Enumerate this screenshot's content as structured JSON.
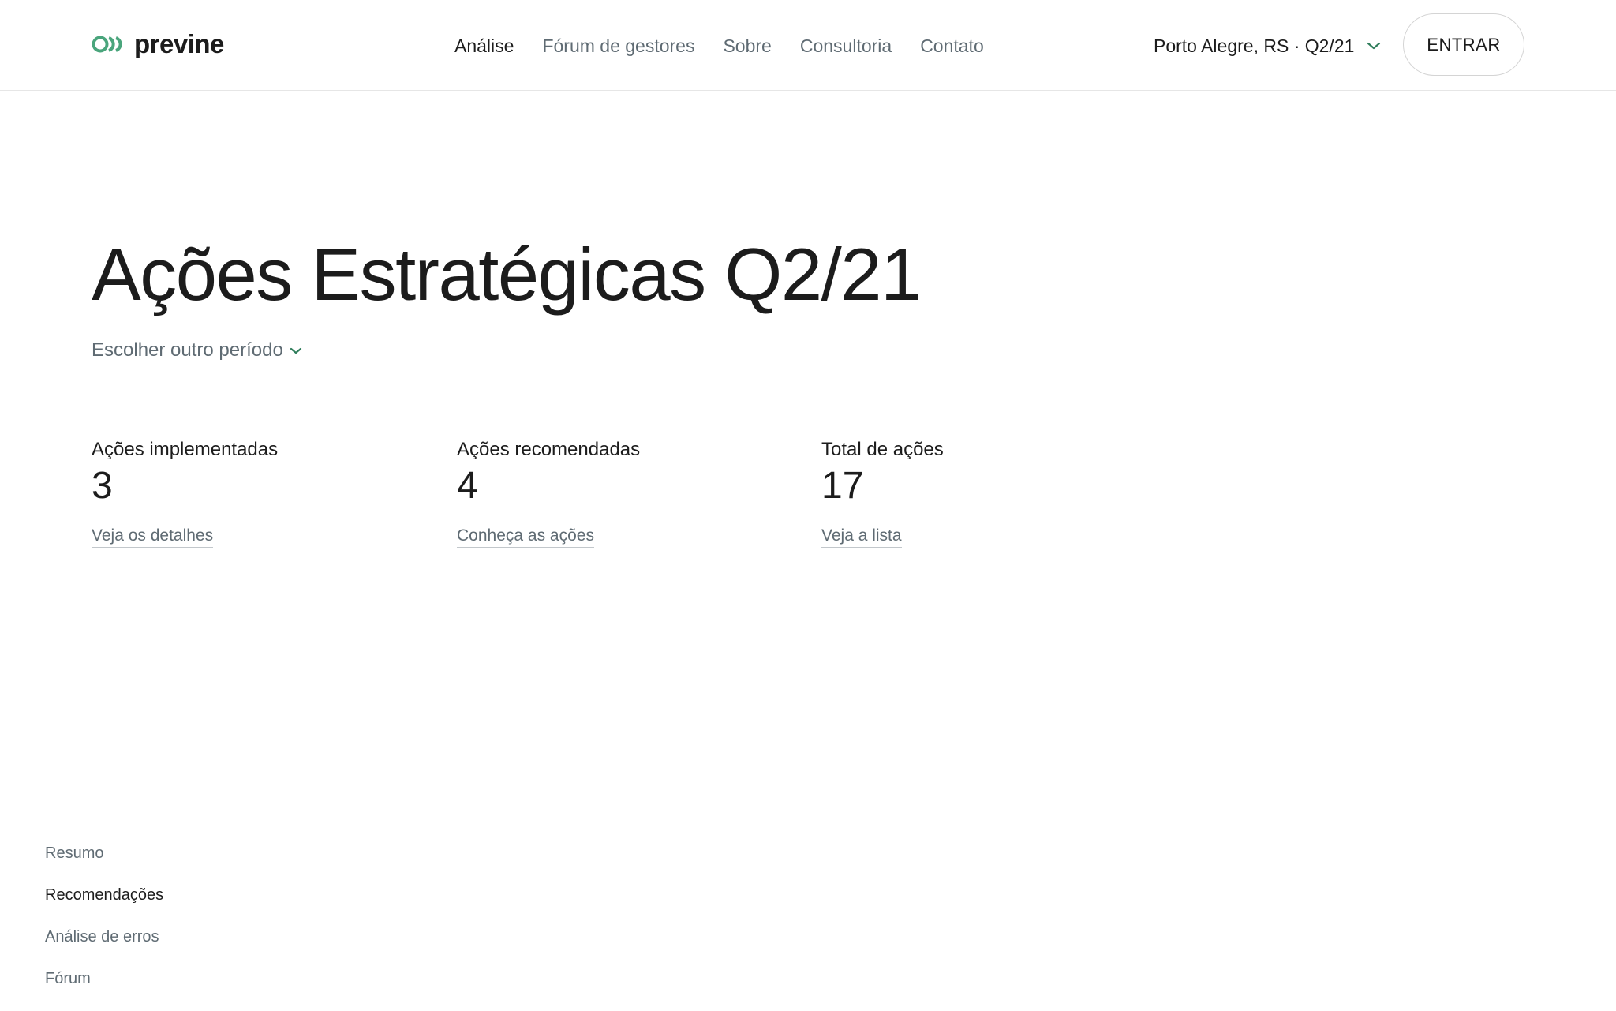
{
  "header": {
    "logo_text": "previne",
    "nav": [
      {
        "label": "Análise",
        "active": true
      },
      {
        "label": "Fórum de gestores",
        "active": false
      },
      {
        "label": "Sobre",
        "active": false
      },
      {
        "label": "Consultoria",
        "active": false
      },
      {
        "label": "Contato",
        "active": false
      }
    ],
    "location": "Porto Alegre, RS · Q2/21",
    "login_label": "ENTRAR"
  },
  "hero": {
    "title": "Ações Estratégicas Q2/21",
    "period_label": "Escolher outro período"
  },
  "stats": [
    {
      "label": "Ações implementadas",
      "value": "3",
      "link": "Veja os detalhes"
    },
    {
      "label": "Ações recomendadas",
      "value": "4",
      "link": "Conheça as ações"
    },
    {
      "label": "Total de ações",
      "value": "17",
      "link": "Veja a lista"
    }
  ],
  "side_nav": [
    {
      "label": "Resumo",
      "active": false
    },
    {
      "label": "Recomendações",
      "active": true
    },
    {
      "label": "Análise de erros",
      "active": false
    },
    {
      "label": "Fórum",
      "active": false
    }
  ],
  "colors": {
    "brand_green": "#4aa57c",
    "text_dark": "#1c1c1c",
    "text_muted": "#5f6b73"
  }
}
